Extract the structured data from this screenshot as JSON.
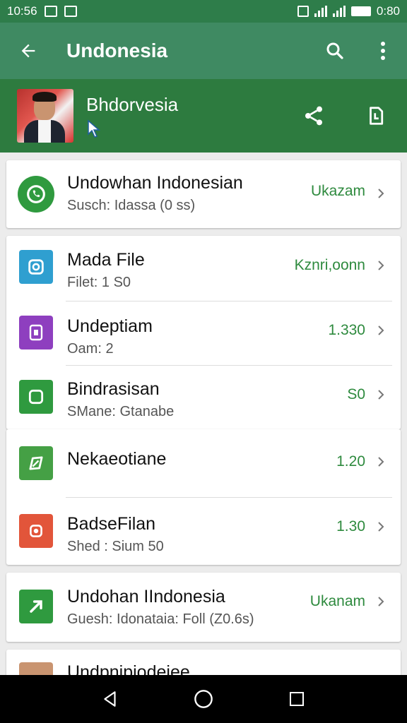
{
  "status_bar": {
    "time": "10:56",
    "battery_text": "0:80"
  },
  "app_bar": {
    "title": "Undonesia"
  },
  "profile": {
    "name": "Bhdorvesia"
  },
  "cards": [
    {
      "rows": [
        {
          "title": "Undowhan Indonesian",
          "subtitle": "Susch: Idassa (0 ss)",
          "value": "Ukazam",
          "icon": "whatsapp-icon",
          "icon_color": "#2f9a3f"
        }
      ]
    },
    {
      "rows": [
        {
          "title": "Mada File",
          "subtitle": "Filet: 1 S0",
          "value": "Kznri,oonn",
          "icon": "camera-icon",
          "icon_color": "#2f9fd0"
        },
        {
          "title": "Undeptiam",
          "subtitle": "Oam: 2",
          "value": "1.330",
          "icon": "tablet-icon",
          "icon_color": "#8e3fbf"
        },
        {
          "title": "Bindrasisan",
          "subtitle": "SMane: Gtanabe",
          "value": "S0",
          "icon": "square-icon",
          "icon_color": "#2f9a3f"
        }
      ]
    },
    {
      "rows": [
        {
          "title": "Nekaeotiane",
          "subtitle": "",
          "value": "1.20",
          "icon": "leaf-icon",
          "icon_color": "#45a045"
        },
        {
          "title": "BadseFilan",
          "subtitle": "Shed : Sium 50",
          "value": "1.30",
          "icon": "record-icon",
          "icon_color": "#e2553a"
        }
      ]
    },
    {
      "rows": [
        {
          "title": "Undohan IIndonesia",
          "subtitle": "Guesh: Idonataia: Foll (Z0.6s)",
          "value": "Ukanam",
          "icon": "play-arrow-icon",
          "icon_color": "#2f9a3f"
        }
      ]
    },
    {
      "rows": [
        {
          "title": "Undpnipiodeiee",
          "subtitle": "",
          "value": "",
          "icon": "avatar",
          "icon_color": "#c99470"
        }
      ]
    }
  ]
}
